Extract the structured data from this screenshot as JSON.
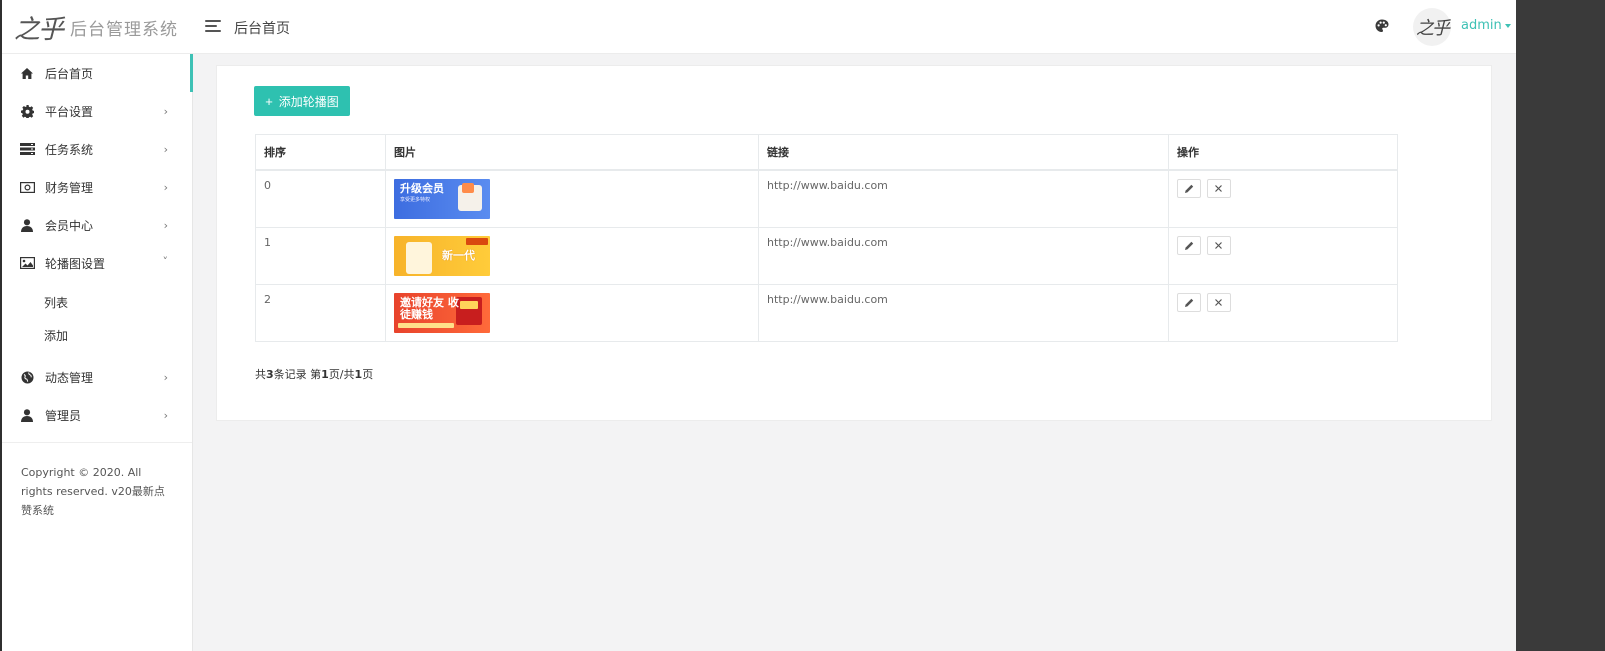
{
  "brand": {
    "logo": "之乎",
    "title": "后台管理系统"
  },
  "header": {
    "title": "后台首页",
    "username": "admin"
  },
  "sidebar": {
    "items": [
      {
        "label": "后台首页",
        "icon": "home-icon"
      },
      {
        "label": "平台设置",
        "icon": "gear-icon"
      },
      {
        "label": "任务系统",
        "icon": "server-icon"
      },
      {
        "label": "财务管理",
        "icon": "money-icon"
      },
      {
        "label": "会员中心",
        "icon": "user-icon"
      },
      {
        "label": "轮播图设置",
        "icon": "image-icon"
      },
      {
        "label": "动态管理",
        "icon": "globe-icon"
      },
      {
        "label": "管理员",
        "icon": "user-icon"
      }
    ],
    "submenu": [
      "列表",
      "添加"
    ],
    "copyright": "Copyright © 2020. All rights reserved. v20最新点赞系统"
  },
  "toolbar": {
    "add_label": "添加轮播图"
  },
  "table": {
    "headers": [
      "排序",
      "图片",
      "链接",
      "操作"
    ],
    "rows": [
      {
        "order": "0",
        "link": "http://www.baidu.com",
        "banner_title": "升级会员",
        "banner_sub": "享受更多特权"
      },
      {
        "order": "1",
        "link": "http://www.baidu.com",
        "banner_title": "新一代",
        "banner_sub": ""
      },
      {
        "order": "2",
        "link": "http://www.baidu.com",
        "banner_title": "邀请好友 收徒赚钱",
        "banner_sub": ""
      }
    ]
  },
  "pager": {
    "prefix": "共",
    "total": "3",
    "mid1": "条记录 第",
    "page": "1",
    "mid2": "页/共",
    "pages": "1",
    "suffix": "页"
  },
  "colors": {
    "accent": "#2ec1b0",
    "link": "#3ec1b5"
  }
}
